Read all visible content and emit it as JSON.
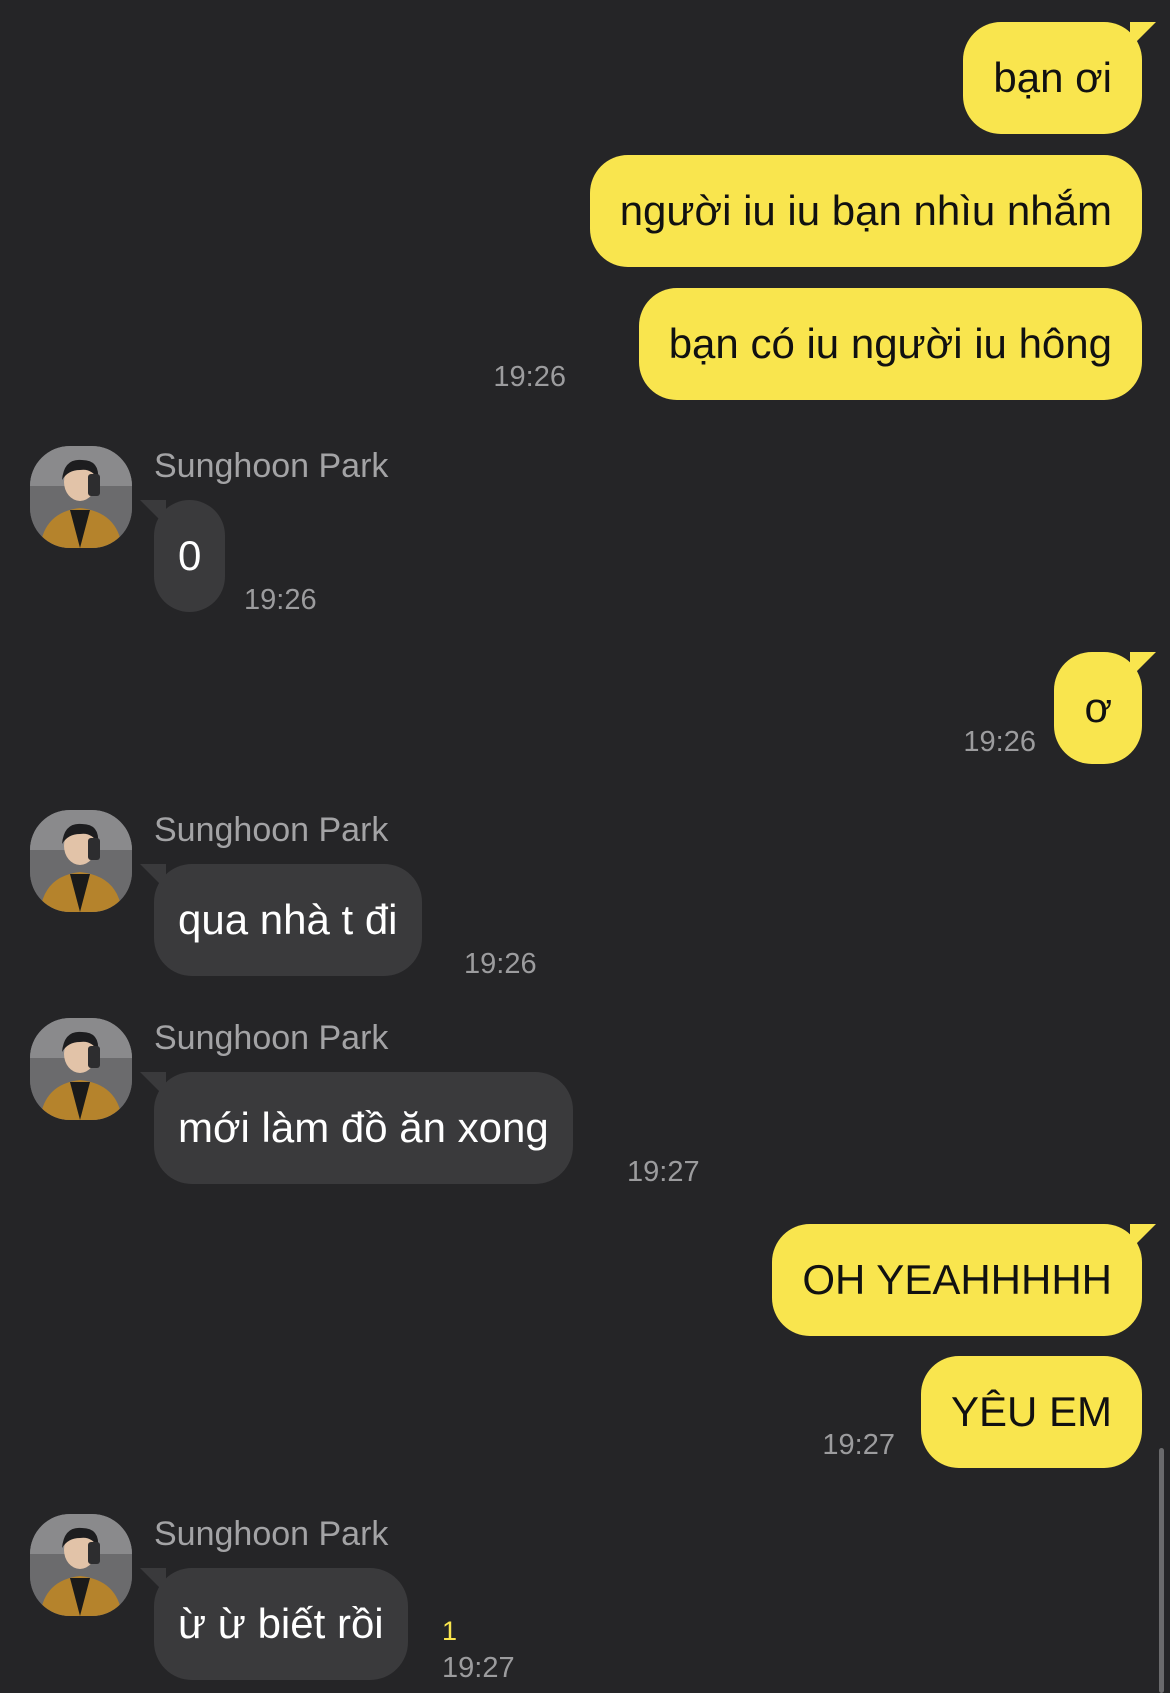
{
  "colors": {
    "background": "#252527",
    "outgoing_bubble": "#f9e54e",
    "incoming_bubble": "#3a3a3c",
    "timestamp": "#9c9c9e",
    "unread": "#f9e54e"
  },
  "contact": {
    "name": "Sunghoon Park",
    "avatar_icon": "profile-photo-avatar"
  },
  "messages": [
    {
      "from": "me",
      "text": "bạn ơi"
    },
    {
      "from": "me",
      "text": "người iu iu bạn nhìu nhắm"
    },
    {
      "from": "me",
      "text": "bạn có iu người iu hông",
      "time": "19:26"
    },
    {
      "from": "them",
      "sender": "Sunghoon Park",
      "text": "0",
      "time": "19:26"
    },
    {
      "from": "me",
      "text": "ơ",
      "time": "19:26"
    },
    {
      "from": "them",
      "sender": "Sunghoon Park",
      "text": "qua nhà t đi",
      "time": "19:26"
    },
    {
      "from": "them",
      "sender": "Sunghoon Park",
      "text": "mới làm đồ ăn xong",
      "time": "19:27"
    },
    {
      "from": "me",
      "text": "OH YEAHHHHH"
    },
    {
      "from": "me",
      "text": "YÊU EM",
      "time": "19:27"
    },
    {
      "from": "them",
      "sender": "Sunghoon Park",
      "text": "ừ ừ biết rồi",
      "time": "19:27",
      "unread_count": "1"
    }
  ]
}
